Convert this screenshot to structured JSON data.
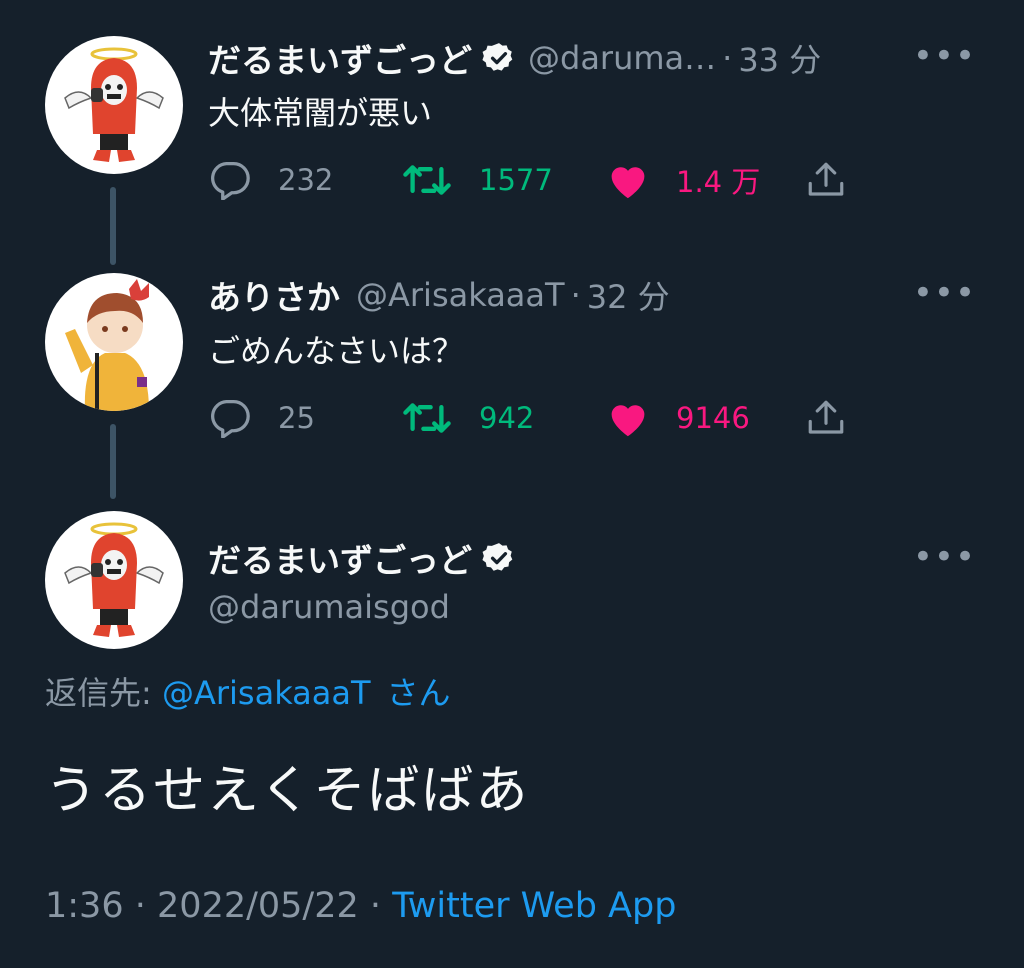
{
  "tweets": [
    {
      "name": "だるまいずごっど",
      "handle": "@daruma…",
      "time": "33 分",
      "text": "大体常闇が悪い",
      "replies": "232",
      "retweets": "1577",
      "likes": "1.4 万"
    },
    {
      "name": "ありさか",
      "handle": "@ArisakaaaT",
      "time": "32 分",
      "text": "ごめんなさいは？",
      "replies": "25",
      "retweets": "942",
      "likes": "9146"
    }
  ],
  "main_tweet": {
    "name": "だるまいずごっど",
    "handle": "@darumaisgod",
    "replying_prefix": "返信先:",
    "replying_mention": "@ArisakaaaT",
    "replying_suffix": "さん",
    "text": "うるせえくそばばあ",
    "time": "1:36",
    "date": "2022/05/22",
    "source": "Twitter Web App"
  },
  "ui": {
    "separator": "·",
    "more": "•••"
  },
  "colors": {
    "background": "#15202b",
    "secondary_text": "#8b98a5",
    "retweet": "#00ba7c",
    "like": "#f91880",
    "link": "#1d9bf0"
  }
}
